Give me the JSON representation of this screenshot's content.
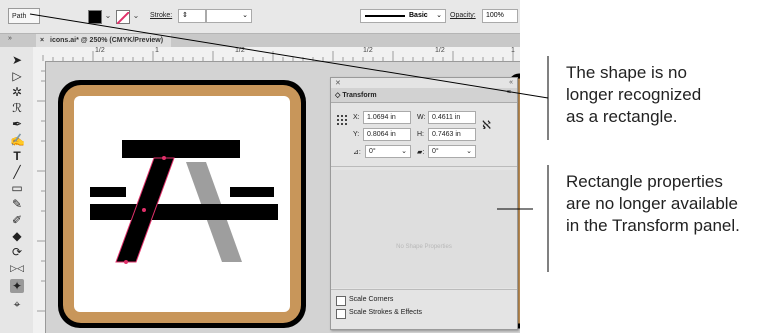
{
  "control_bar": {
    "path_label": "Path",
    "stroke_label": "Stroke:",
    "stroke_style_label": "Basic",
    "opacity_label": "Opacity:",
    "opacity_value": "100%"
  },
  "document_tab": {
    "close": "×",
    "title": "icons.ai* @ 250% (CMYK/Preview)"
  },
  "ruler": {
    "marks": [
      "1/2",
      "1",
      "1/2",
      "1/2",
      "1/2",
      "1"
    ]
  },
  "transform_panel": {
    "title": "Transform",
    "x_label": "X:",
    "x_value": "1.0694 in",
    "y_label": "Y:",
    "y_value": "0.8064 in",
    "w_label": "W:",
    "w_value": "0.4611 in",
    "h_label": "H:",
    "h_value": "0.7463 in",
    "angle_value": "0°",
    "shear_value": "0°",
    "no_shape_text": "No Shape Properties",
    "scale_corners_label": "Scale Corners",
    "scale_strokes_label": "Scale Strokes & Effects"
  },
  "callouts": {
    "first": [
      "The shape is no",
      "longer recognized",
      "as a rectangle."
    ],
    "second": [
      "Rectangle properties",
      "are no longer available",
      "in the Transform panel."
    ]
  },
  "colors": {
    "icon_border": "#c8965a",
    "icon_bg": "#ffffff",
    "gray_leg": "#9e9e9e",
    "selection": "#e0306a"
  }
}
